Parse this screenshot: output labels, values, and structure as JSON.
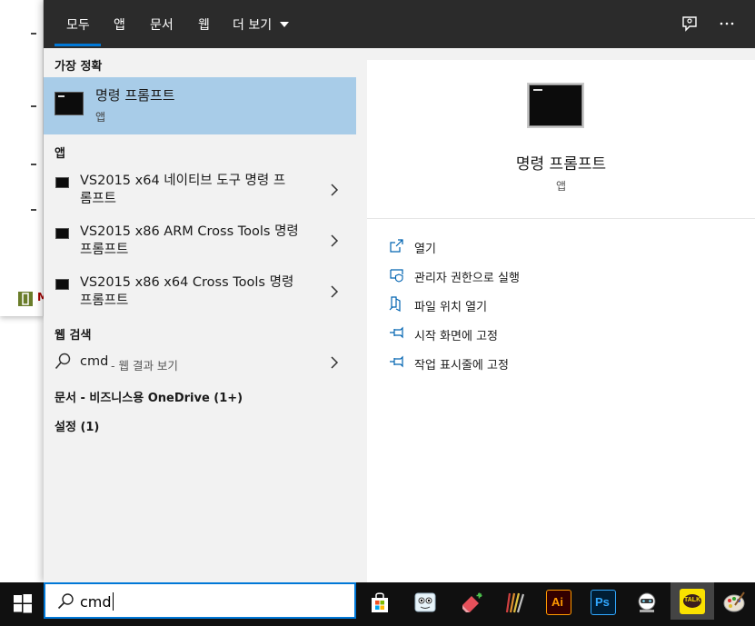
{
  "tabs": {
    "all": "모두",
    "apps": "앱",
    "documents": "문서",
    "web": "웹",
    "more": "더 보기"
  },
  "best_match": {
    "heading": "가장 정확",
    "title": "명령 프롬프트",
    "subtitle": "앱"
  },
  "apps": {
    "heading": "앱",
    "items": [
      {
        "line1": "VS2015 x64 네이티브 도구 명령 프",
        "line2": "롬프트"
      },
      {
        "line1": "VS2015 x86 ARM Cross Tools 명령",
        "line2": "프롬프트"
      },
      {
        "line1": "VS2015 x86 x64 Cross Tools 명령",
        "line2": "프롬프트"
      }
    ]
  },
  "web_search": {
    "heading": "웹 검색",
    "query": "cmd",
    "hint": "- 웹 결과 보기"
  },
  "documents": {
    "label": "문서 - 비즈니스용 OneDrive (1+)"
  },
  "settings": {
    "label": "설정 (1)"
  },
  "preview": {
    "title": "명령 프롬프트",
    "subtitle": "앱",
    "actions": {
      "open": "열기",
      "run_admin": "관리자 권한으로 실행",
      "open_location": "파일 위치 열기",
      "pin_start": "시작 화면에 고정",
      "pin_taskbar": "작업 표시줄에 고정"
    }
  },
  "taskbar": {
    "search_value": "cmd",
    "icons": [
      "store-icon",
      "paint-3d-icon",
      "eraser-app-icon",
      "palette-app-icon",
      "illustrator-icon",
      "photoshop-icon",
      "robot-app-icon",
      "kakaotalk-icon",
      "paint-icon"
    ],
    "illustrator_text": "Ai",
    "photoshop_text": "Ps",
    "kakaotalk_text": "TALK"
  },
  "background_window": {
    "visible_letter": "M"
  },
  "colors": {
    "accent": "#0078d7",
    "selection": "#a8cce8",
    "topbar": "#2b2b2b",
    "taskbar": "#101010"
  }
}
